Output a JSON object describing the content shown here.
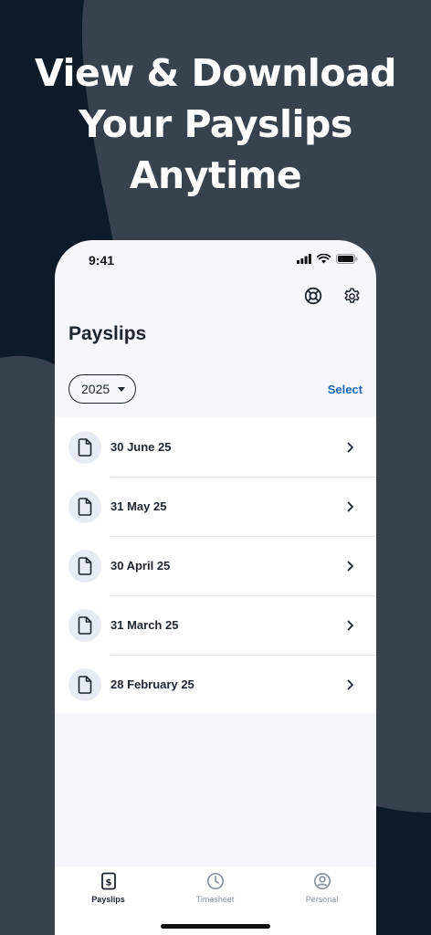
{
  "headline": {
    "lines": [
      "View & Download",
      "Your Payslips",
      "Anytime"
    ]
  },
  "colors": {
    "background": "#0d1a27",
    "shape": "#38424f",
    "accent": "#1f66b8",
    "text": "#1c2530",
    "screen": "#f5f7fc"
  },
  "status_bar": {
    "time": "9:41",
    "icons": [
      "signal-icon",
      "wifi-icon",
      "battery-icon"
    ]
  },
  "header": {
    "actions": [
      "help-lifebuoy-icon",
      "settings-gear-icon"
    ]
  },
  "page": {
    "title": "Payslips",
    "year_filter": "2025",
    "select_label": "Select"
  },
  "payslips": [
    {
      "label": "30 June 25"
    },
    {
      "label": "31 May 25"
    },
    {
      "label": "30 April 25"
    },
    {
      "label": "31 March 25"
    },
    {
      "label": "28 February 25"
    }
  ],
  "tab_bar": {
    "tabs": [
      {
        "label": "Payslips",
        "icon": "payslip-icon",
        "active": true
      },
      {
        "label": "Timesheet",
        "icon": "clock-icon",
        "active": false
      },
      {
        "label": "Personal",
        "icon": "user-icon",
        "active": false
      }
    ]
  }
}
